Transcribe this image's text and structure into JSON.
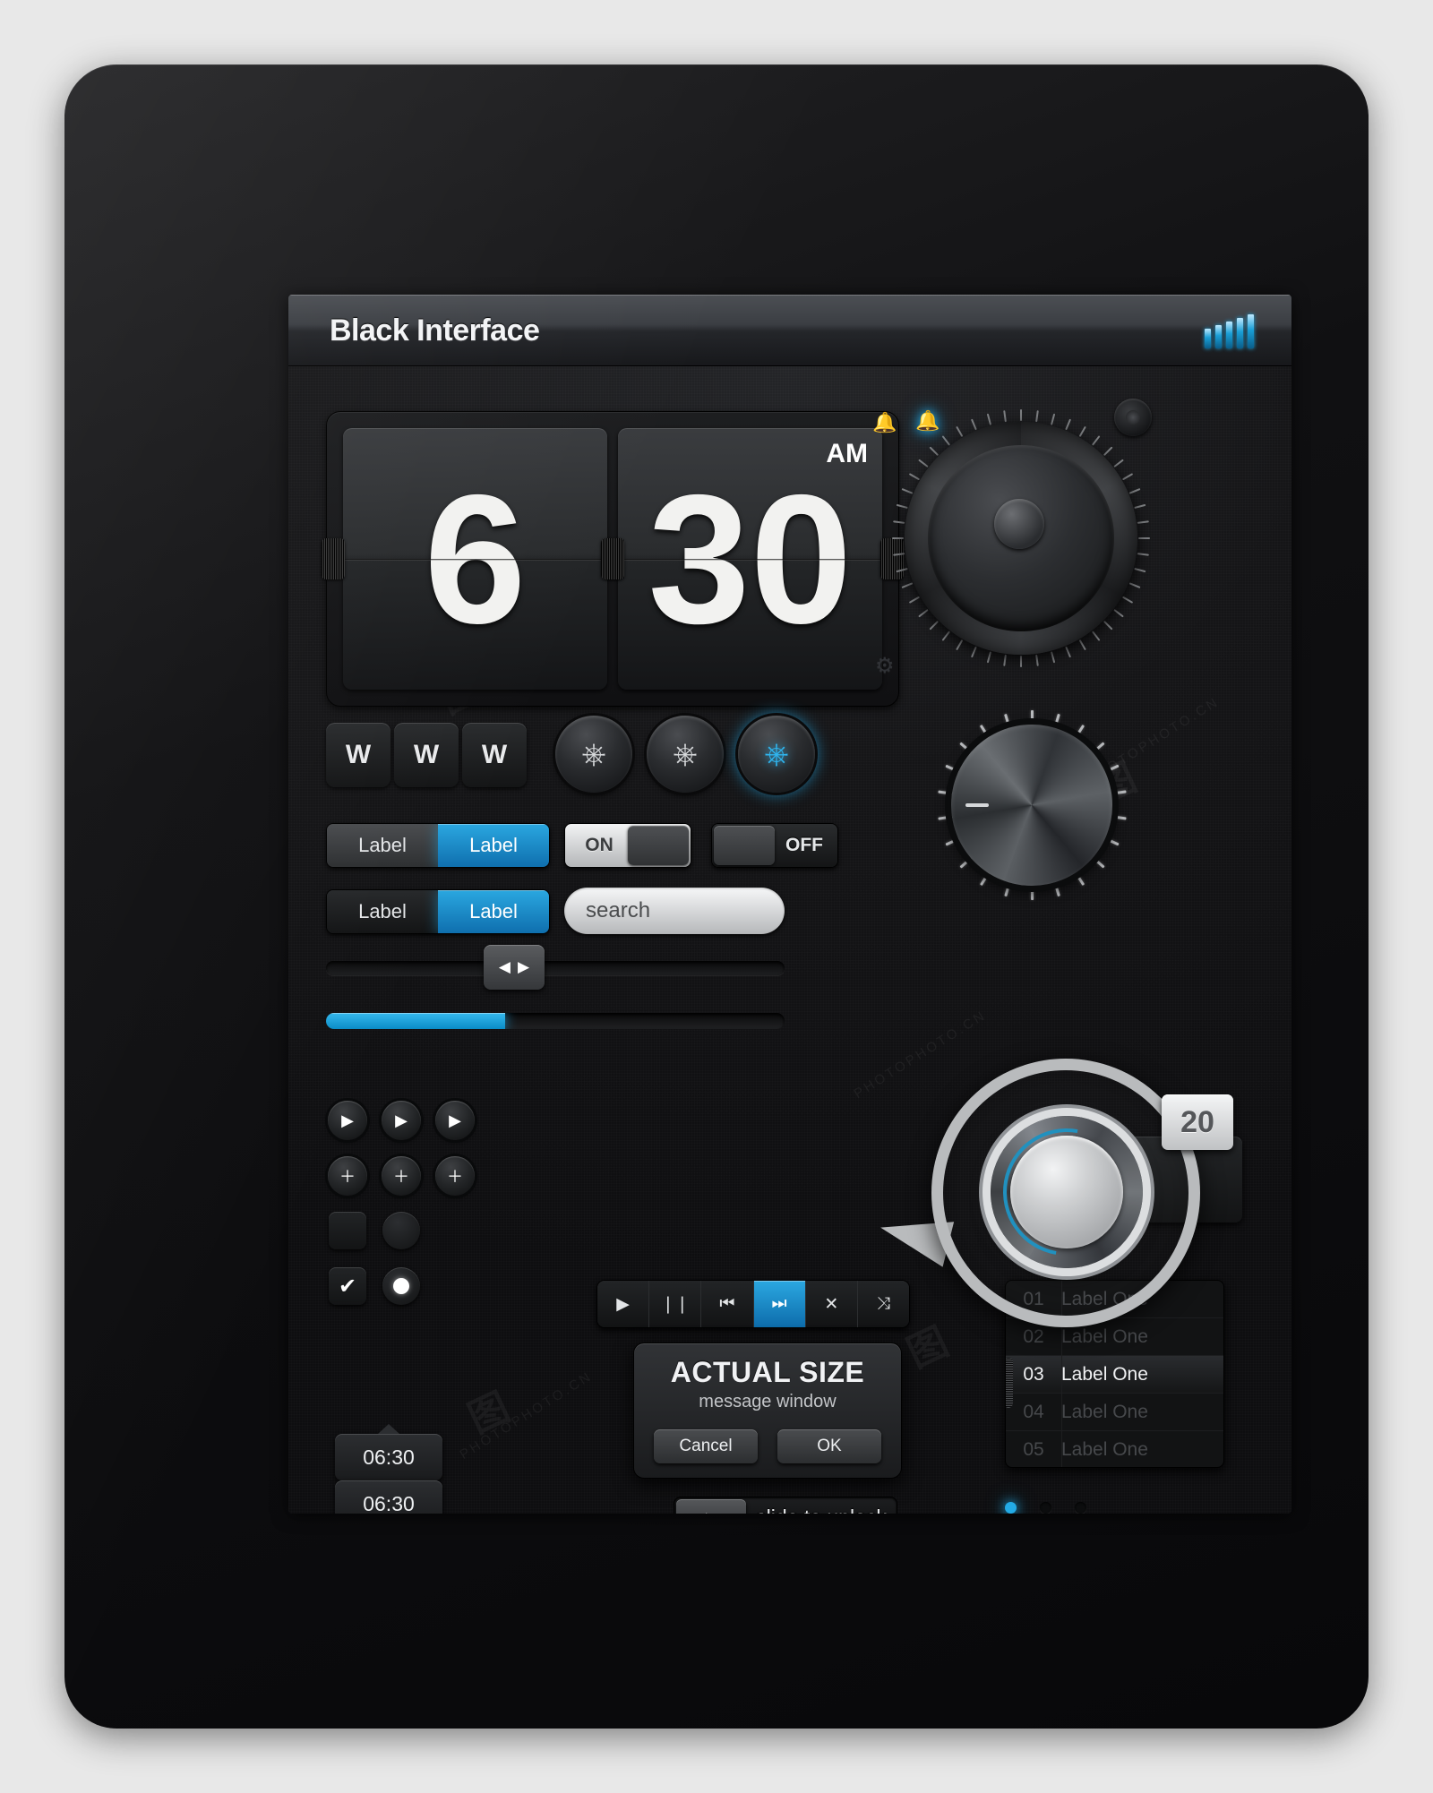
{
  "window": {
    "title": "Black Interface",
    "signal_bars": 5
  },
  "clock": {
    "hours": "6",
    "minutes": "30",
    "meridiem": "AM"
  },
  "indicators": {
    "bell_off_icon": "bell-off-icon",
    "bell_on_icon": "bell-on-icon",
    "gear_icon": "gear-icon"
  },
  "w_buttons": [
    {
      "label": "W"
    },
    {
      "label": "W"
    },
    {
      "label": "W"
    }
  ],
  "power_buttons": [
    {
      "icon": "power-icon",
      "active": false
    },
    {
      "icon": "power-icon",
      "active": false
    },
    {
      "icon": "power-icon",
      "active": true
    }
  ],
  "segment_row_1": {
    "segments": [
      {
        "label": "Label",
        "selected": false
      },
      {
        "label": "Label",
        "selected": true
      }
    ]
  },
  "segment_row_2": {
    "segments": [
      {
        "label": "Label",
        "selected": false
      },
      {
        "label": "Label",
        "selected": true
      }
    ]
  },
  "switches": [
    {
      "label": "ON",
      "state": "on"
    },
    {
      "label": "OFF",
      "state": "off"
    }
  ],
  "search": {
    "value": "search",
    "placeholder": "search",
    "icon": "search-knob-icon"
  },
  "slider": {
    "left_arrow": "◀",
    "right_arrow": "▶",
    "handle_percent": 39
  },
  "progress": {
    "percent": 39
  },
  "round_buttons_row_1": [
    {
      "icon": "play-icon",
      "glyph": "▶"
    },
    {
      "icon": "play-icon",
      "glyph": "▶"
    },
    {
      "icon": "play-icon",
      "glyph": "▶"
    }
  ],
  "round_buttons_row_2": [
    {
      "icon": "plus-icon",
      "glyph": "＋"
    },
    {
      "icon": "plus-icon",
      "glyph": "＋"
    },
    {
      "icon": "plus-icon",
      "glyph": "＋"
    }
  ],
  "checkbox_unchecked": {
    "icon": "checkbox-unchecked-icon",
    "glyph": ""
  },
  "radio_unselected": {
    "icon": "radio-unselected-icon"
  },
  "checkbox_checked": {
    "icon": "checkbox-checked-icon",
    "glyph": "✔"
  },
  "radio_selected": {
    "icon": "radio-selected-icon"
  },
  "media_bar": [
    {
      "name": "play-icon",
      "glyph": "▶",
      "active": false
    },
    {
      "name": "pause-icon",
      "glyph": "❘❘",
      "active": false
    },
    {
      "name": "previous-icon",
      "glyph": "⏮",
      "active": false
    },
    {
      "name": "next-icon",
      "glyph": "⏭",
      "active": true
    },
    {
      "name": "close-icon",
      "glyph": "✕",
      "active": false
    },
    {
      "name": "shuffle-icon",
      "glyph": "⤨",
      "active": false
    }
  ],
  "dialog": {
    "title": "ACTUAL SIZE",
    "subtitle": "message window",
    "cancel_label": "Cancel",
    "ok_label": "OK"
  },
  "list": {
    "rows": [
      {
        "number": "01",
        "label": "Label One",
        "selected": false
      },
      {
        "number": "02",
        "label": "Label One",
        "selected": false
      },
      {
        "number": "03",
        "label": "Label One",
        "selected": true
      },
      {
        "number": "04",
        "label": "Label One",
        "selected": false
      },
      {
        "number": "05",
        "label": "Label One",
        "selected": false
      }
    ]
  },
  "stepper_value": "20",
  "time_bubbles": [
    {
      "value": "06:30",
      "tip": "up"
    },
    {
      "value": "06:30",
      "tip": "down"
    }
  ],
  "unlock": {
    "handle_icon": "play-icon",
    "handle_glyph": "▶",
    "label": "slide to unlock"
  },
  "page_dots": [
    {
      "active": true
    },
    {
      "active": false
    },
    {
      "active": false
    }
  ],
  "colors": {
    "accent_blue": "#21a9e6",
    "panel_bg": "#141415",
    "text_primary": "#f1f2f4",
    "text_dim": "#46484b"
  },
  "watermark": {
    "text": "PHOTOPHOTO.CN"
  }
}
